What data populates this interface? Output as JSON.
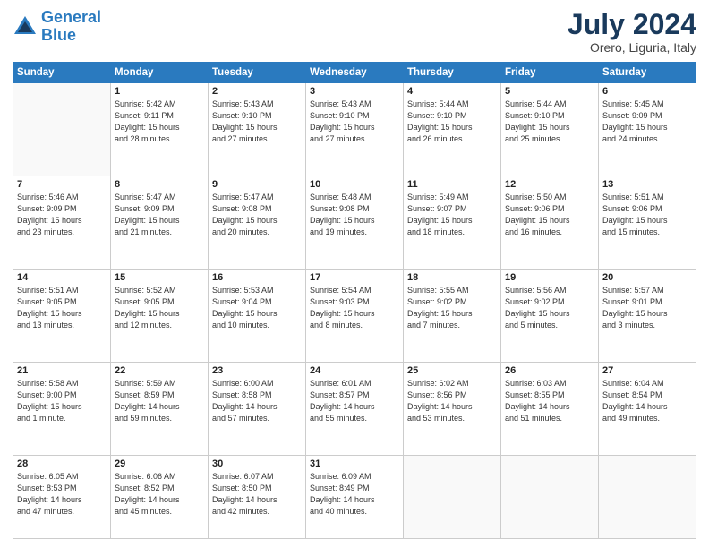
{
  "header": {
    "logo_line1": "General",
    "logo_line2": "Blue",
    "month": "July 2024",
    "location": "Orero, Liguria, Italy"
  },
  "weekdays": [
    "Sunday",
    "Monday",
    "Tuesday",
    "Wednesday",
    "Thursday",
    "Friday",
    "Saturday"
  ],
  "weeks": [
    [
      {
        "day": "",
        "info": ""
      },
      {
        "day": "1",
        "info": "Sunrise: 5:42 AM\nSunset: 9:11 PM\nDaylight: 15 hours\nand 28 minutes."
      },
      {
        "day": "2",
        "info": "Sunrise: 5:43 AM\nSunset: 9:10 PM\nDaylight: 15 hours\nand 27 minutes."
      },
      {
        "day": "3",
        "info": "Sunrise: 5:43 AM\nSunset: 9:10 PM\nDaylight: 15 hours\nand 27 minutes."
      },
      {
        "day": "4",
        "info": "Sunrise: 5:44 AM\nSunset: 9:10 PM\nDaylight: 15 hours\nand 26 minutes."
      },
      {
        "day": "5",
        "info": "Sunrise: 5:44 AM\nSunset: 9:10 PM\nDaylight: 15 hours\nand 25 minutes."
      },
      {
        "day": "6",
        "info": "Sunrise: 5:45 AM\nSunset: 9:09 PM\nDaylight: 15 hours\nand 24 minutes."
      }
    ],
    [
      {
        "day": "7",
        "info": "Sunrise: 5:46 AM\nSunset: 9:09 PM\nDaylight: 15 hours\nand 23 minutes."
      },
      {
        "day": "8",
        "info": "Sunrise: 5:47 AM\nSunset: 9:09 PM\nDaylight: 15 hours\nand 21 minutes."
      },
      {
        "day": "9",
        "info": "Sunrise: 5:47 AM\nSunset: 9:08 PM\nDaylight: 15 hours\nand 20 minutes."
      },
      {
        "day": "10",
        "info": "Sunrise: 5:48 AM\nSunset: 9:08 PM\nDaylight: 15 hours\nand 19 minutes."
      },
      {
        "day": "11",
        "info": "Sunrise: 5:49 AM\nSunset: 9:07 PM\nDaylight: 15 hours\nand 18 minutes."
      },
      {
        "day": "12",
        "info": "Sunrise: 5:50 AM\nSunset: 9:06 PM\nDaylight: 15 hours\nand 16 minutes."
      },
      {
        "day": "13",
        "info": "Sunrise: 5:51 AM\nSunset: 9:06 PM\nDaylight: 15 hours\nand 15 minutes."
      }
    ],
    [
      {
        "day": "14",
        "info": "Sunrise: 5:51 AM\nSunset: 9:05 PM\nDaylight: 15 hours\nand 13 minutes."
      },
      {
        "day": "15",
        "info": "Sunrise: 5:52 AM\nSunset: 9:05 PM\nDaylight: 15 hours\nand 12 minutes."
      },
      {
        "day": "16",
        "info": "Sunrise: 5:53 AM\nSunset: 9:04 PM\nDaylight: 15 hours\nand 10 minutes."
      },
      {
        "day": "17",
        "info": "Sunrise: 5:54 AM\nSunset: 9:03 PM\nDaylight: 15 hours\nand 8 minutes."
      },
      {
        "day": "18",
        "info": "Sunrise: 5:55 AM\nSunset: 9:02 PM\nDaylight: 15 hours\nand 7 minutes."
      },
      {
        "day": "19",
        "info": "Sunrise: 5:56 AM\nSunset: 9:02 PM\nDaylight: 15 hours\nand 5 minutes."
      },
      {
        "day": "20",
        "info": "Sunrise: 5:57 AM\nSunset: 9:01 PM\nDaylight: 15 hours\nand 3 minutes."
      }
    ],
    [
      {
        "day": "21",
        "info": "Sunrise: 5:58 AM\nSunset: 9:00 PM\nDaylight: 15 hours\nand 1 minute."
      },
      {
        "day": "22",
        "info": "Sunrise: 5:59 AM\nSunset: 8:59 PM\nDaylight: 14 hours\nand 59 minutes."
      },
      {
        "day": "23",
        "info": "Sunrise: 6:00 AM\nSunset: 8:58 PM\nDaylight: 14 hours\nand 57 minutes."
      },
      {
        "day": "24",
        "info": "Sunrise: 6:01 AM\nSunset: 8:57 PM\nDaylight: 14 hours\nand 55 minutes."
      },
      {
        "day": "25",
        "info": "Sunrise: 6:02 AM\nSunset: 8:56 PM\nDaylight: 14 hours\nand 53 minutes."
      },
      {
        "day": "26",
        "info": "Sunrise: 6:03 AM\nSunset: 8:55 PM\nDaylight: 14 hours\nand 51 minutes."
      },
      {
        "day": "27",
        "info": "Sunrise: 6:04 AM\nSunset: 8:54 PM\nDaylight: 14 hours\nand 49 minutes."
      }
    ],
    [
      {
        "day": "28",
        "info": "Sunrise: 6:05 AM\nSunset: 8:53 PM\nDaylight: 14 hours\nand 47 minutes."
      },
      {
        "day": "29",
        "info": "Sunrise: 6:06 AM\nSunset: 8:52 PM\nDaylight: 14 hours\nand 45 minutes."
      },
      {
        "day": "30",
        "info": "Sunrise: 6:07 AM\nSunset: 8:50 PM\nDaylight: 14 hours\nand 42 minutes."
      },
      {
        "day": "31",
        "info": "Sunrise: 6:09 AM\nSunset: 8:49 PM\nDaylight: 14 hours\nand 40 minutes."
      },
      {
        "day": "",
        "info": ""
      },
      {
        "day": "",
        "info": ""
      },
      {
        "day": "",
        "info": ""
      }
    ]
  ]
}
